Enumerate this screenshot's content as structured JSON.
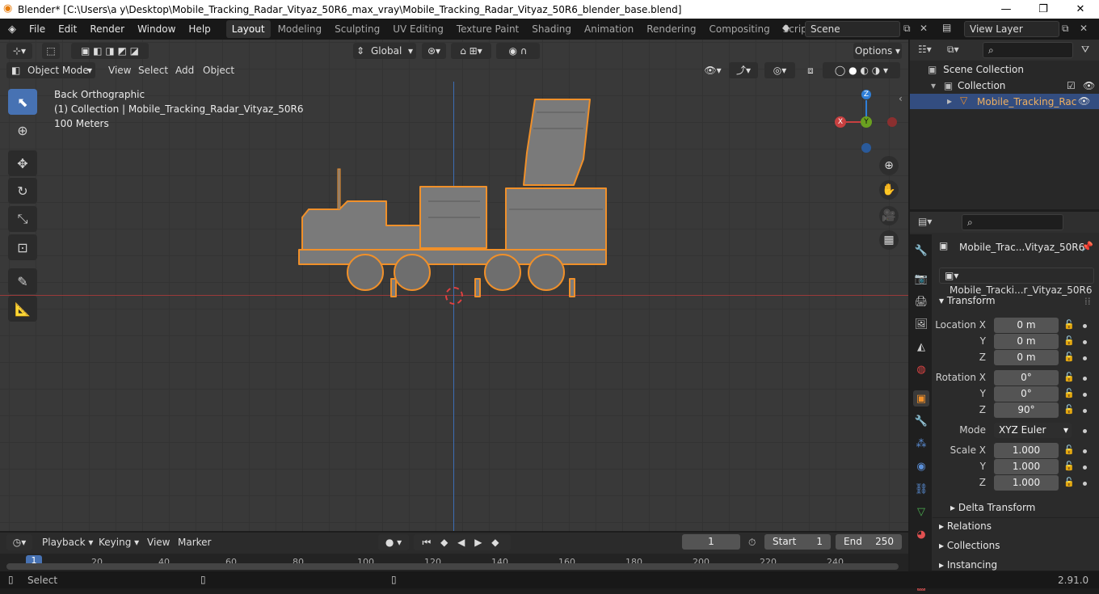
{
  "window": {
    "title": "Blender* [C:\\Users\\a y\\Desktop\\Mobile_Tracking_Radar_Vityaz_50R6_max_vray\\Mobile_Tracking_Radar_Vityaz_50R6_blender_base.blend]",
    "minimize": "—",
    "maximize": "❐",
    "close": "✕"
  },
  "menus": [
    "File",
    "Edit",
    "Render",
    "Window",
    "Help"
  ],
  "workspaces": [
    "Layout",
    "Modeling",
    "Sculpting",
    "UV Editing",
    "Texture Paint",
    "Shading",
    "Animation",
    "Rendering",
    "Compositing",
    "Scripting"
  ],
  "active_workspace": "Layout",
  "scene": {
    "name": "Scene",
    "view_layer": "View Layer"
  },
  "viewport": {
    "mode": "Object Mode",
    "menus": [
      "View",
      "Select",
      "Add",
      "Object"
    ],
    "orientation": "Global",
    "options": "Options",
    "overlay": {
      "view_name": "Back Orthographic",
      "collection_info": "(1) Collection | Mobile_Tracking_Radar_Vityaz_50R6",
      "scale": "100 Meters"
    },
    "gizmo": {
      "z": "Z",
      "x": "X",
      "y": "Y"
    }
  },
  "outliner": {
    "root": "Scene Collection",
    "collection": "Collection",
    "object": "Mobile_Tracking_Rac"
  },
  "properties": {
    "object_name": "Mobile_Trac...Vityaz_50R6",
    "data_name": "Mobile_Tracki...r_Vityaz_50R6",
    "transform_title": "Transform",
    "location": {
      "label": "Location X",
      "x": "0 m",
      "y": "0 m",
      "z": "0 m"
    },
    "rotation": {
      "label": "Rotation X",
      "x": "0°",
      "y": "0°",
      "z": "90°"
    },
    "mode_label": "Mode",
    "mode_value": "XYZ Euler",
    "scale": {
      "label": "Scale X",
      "x": "1.000",
      "y": "1.000",
      "z": "1.000"
    },
    "axis_y": "Y",
    "axis_z": "Z",
    "delta": "Delta Transform",
    "panels": [
      "Relations",
      "Collections",
      "Instancing"
    ]
  },
  "timeline": {
    "menus": [
      "Playback",
      "Keying",
      "View",
      "Marker"
    ],
    "current_frame": "1",
    "start_label": "Start",
    "start": "1",
    "end_label": "End",
    "end": "250",
    "ticks": [
      "1",
      "20",
      "40",
      "60",
      "80",
      "100",
      "120",
      "140",
      "160",
      "180",
      "200",
      "220",
      "240"
    ]
  },
  "statusbar": {
    "left": "Select",
    "version": "2.91.0"
  },
  "colors": {
    "accent": "#4772b3",
    "selection_outline": "#f0902a",
    "x_axis": "#c84040",
    "y_axis": "#6aa020",
    "z_axis": "#2f7fd8"
  }
}
